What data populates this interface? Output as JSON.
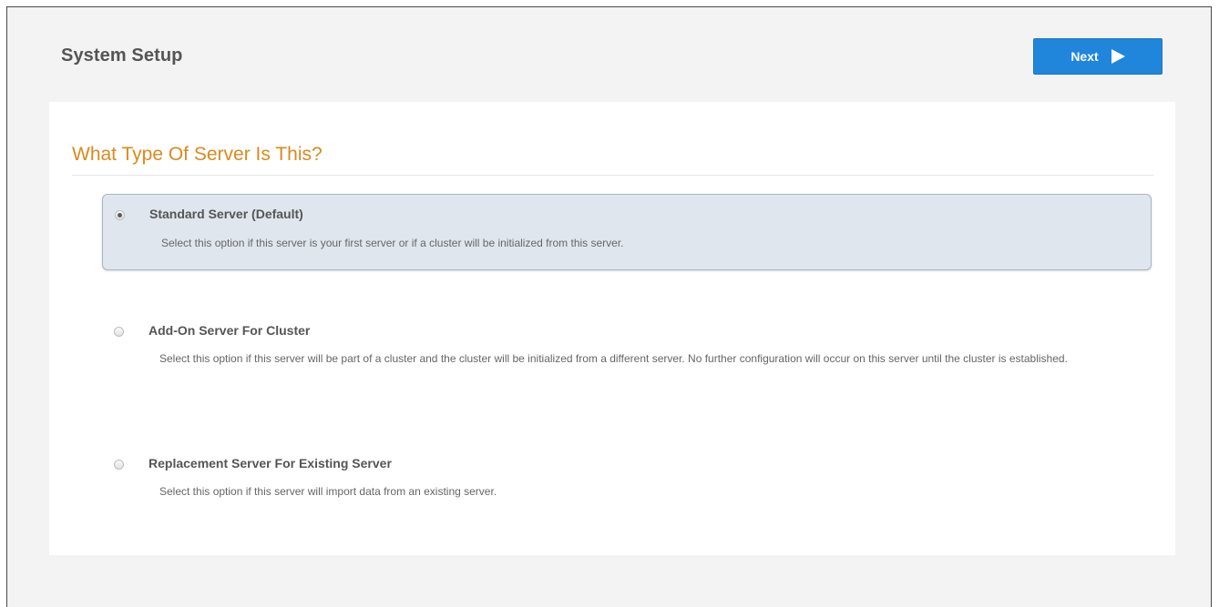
{
  "header": {
    "title": "System Setup",
    "next_label": "Next",
    "next_icon": "play-arrow-icon"
  },
  "section": {
    "title": "What Type Of Server Is This?"
  },
  "options": [
    {
      "label": "Standard Server (Default)",
      "description": "Select this option if this server is your first server or if a cluster will be initialized from this server.",
      "selected": true
    },
    {
      "label": "Add-On Server For Cluster",
      "description": "Select this option if this server will be part of a cluster and the cluster will be initialized from a different server. No further configuration will occur on this server until the cluster is established.",
      "selected": false
    },
    {
      "label": "Replacement Server For Existing Server",
      "description": "Select this option if this server will import data from an existing server.",
      "selected": false
    }
  ],
  "colors": {
    "accent": "#1f86db",
    "section_title": "#d98a1c",
    "selected_background": "#dfe6ee"
  }
}
